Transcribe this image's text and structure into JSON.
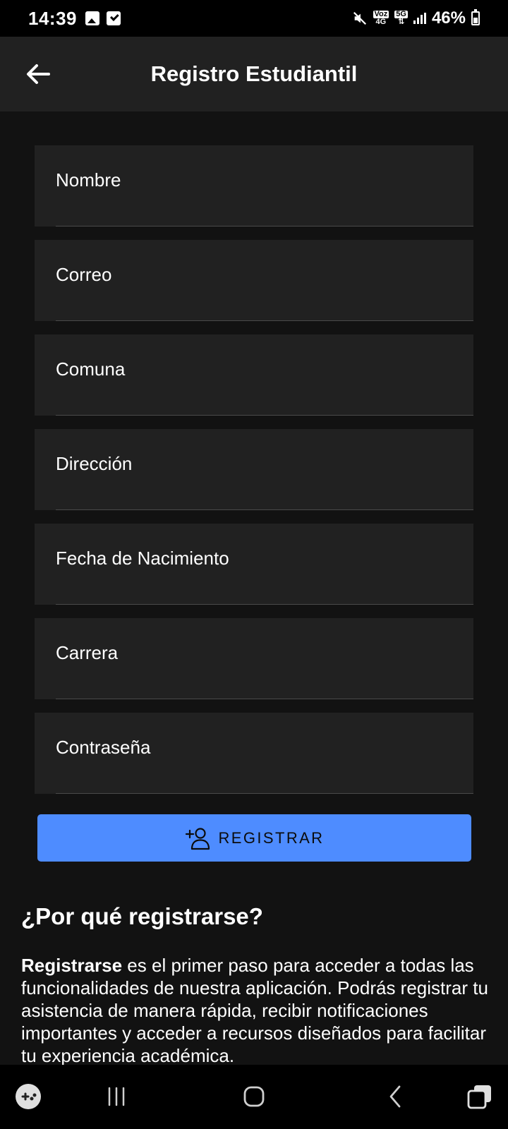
{
  "status_bar": {
    "time": "14:39",
    "net_top": "Voz",
    "net_bottom": "4G",
    "net_5g": "5G",
    "battery": "46%"
  },
  "app_bar": {
    "title": "Registro Estudiantil"
  },
  "form": {
    "fields": [
      {
        "label": "Nombre"
      },
      {
        "label": "Correo"
      },
      {
        "label": "Comuna"
      },
      {
        "label": "Dirección"
      },
      {
        "label": "Fecha de Nacimiento"
      },
      {
        "label": "Carrera"
      },
      {
        "label": "Contraseña"
      }
    ],
    "submit_label": "REGISTRAR"
  },
  "info": {
    "heading": "¿Por qué registrarse?",
    "bold_lead": "Registrarse",
    "body": " es el primer paso para acceder a todas las funcionalidades de nuestra aplicación. Podrás registrar tu asistencia de manera rápida, recibir notificaciones importantes y acceder a recursos diseñados para facilitar tu experiencia académica."
  },
  "colors": {
    "background": "#121212",
    "surface": "#212121",
    "accent": "#4e8cff"
  }
}
